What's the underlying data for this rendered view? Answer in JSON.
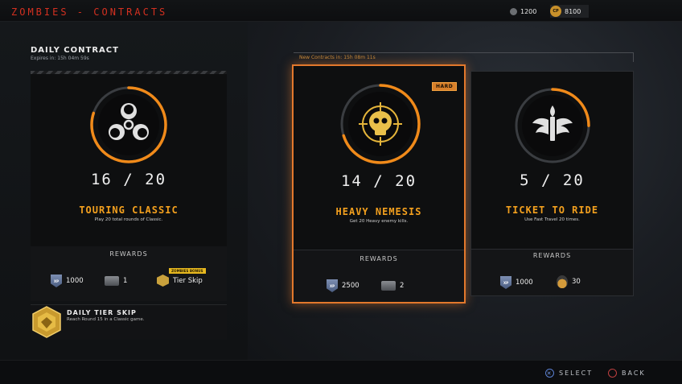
{
  "header": {
    "title": "ZOMBIES - CONTRACTS",
    "bombs": "1200",
    "cp_label": "CP",
    "cp_value": "8100"
  },
  "daily": {
    "title": "DAILY CONTRACT",
    "expires": "Expires in: 15h 04m 59s",
    "progress": "16 / 20",
    "name": "TOURING CLASSIC",
    "desc": "Play 20 total rounds of Classic.",
    "rewards_label": "REWARDS",
    "reward_xp": "1000",
    "reward_cam": "1",
    "bonus_badge": "ZOMBIES BONUS",
    "reward_tier": "Tier Skip",
    "progress_fraction": 0.8
  },
  "tier_skip": {
    "title": "DAILY TIER SKIP",
    "desc": "Reach Round 15 in a Classic game."
  },
  "new_contracts": "New Contracts in: 15h 08m 11s",
  "contract_a": {
    "badge": "HARD",
    "progress": "14 / 20",
    "name": "HEAVY NEMESIS",
    "desc": "Get 20 Heavy enemy kills.",
    "rewards_label": "REWARDS",
    "reward_xp": "2500",
    "reward_cam": "2",
    "progress_fraction": 0.7
  },
  "contract_b": {
    "progress": "5 / 20",
    "name": "TICKET TO RIDE",
    "desc": "Use Fast Travel 20 times.",
    "rewards_label": "REWARDS",
    "reward_xp": "1000",
    "reward_item": "30",
    "progress_fraction": 0.25
  },
  "footer": {
    "select": "SELECT",
    "back": "BACK"
  },
  "colors": {
    "accent": "#f3a01e",
    "title_red": "#d33020",
    "ring_orange": "#f08a1a"
  }
}
